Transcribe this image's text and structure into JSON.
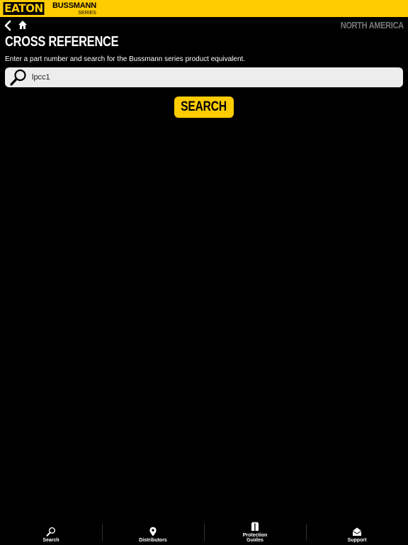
{
  "header": {
    "brand": "EATON",
    "series_name": "BUSSMANN",
    "series_sub": "SERIES"
  },
  "nav": {
    "region": "NORTH AMERICA"
  },
  "page": {
    "title": "CROSS REFERENCE",
    "subtitle": "Enter a part number and search for the Bussmann series product equivalent."
  },
  "search": {
    "value": "lpcc1",
    "button_label": "SEARCH"
  },
  "tabbar": {
    "search": "Search",
    "distributors": "Distributors",
    "protection_guides_1": "Protection",
    "protection_guides_2": "Guides",
    "support": "Support"
  },
  "colors": {
    "accent": "#ffcc00",
    "background": "#000000"
  }
}
